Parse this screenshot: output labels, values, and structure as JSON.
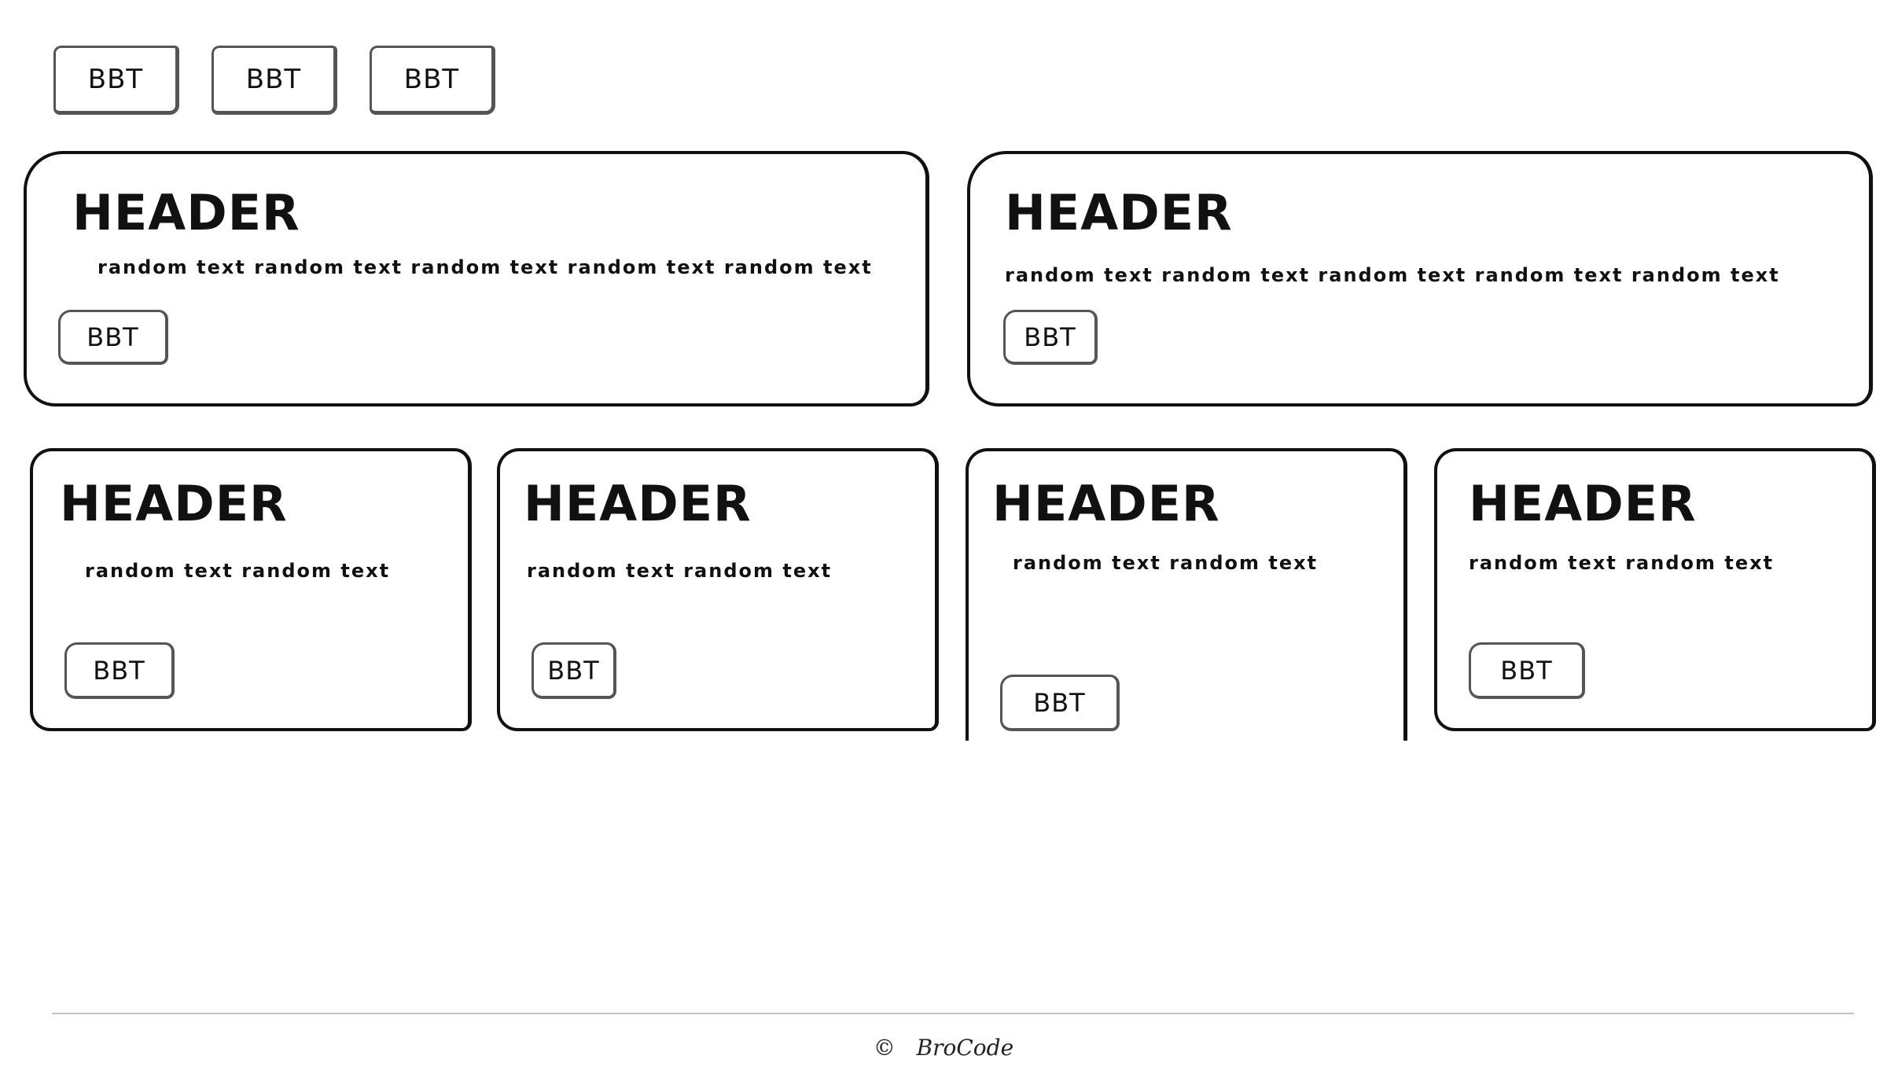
{
  "toolbar": {
    "buttons": [
      {
        "label": "BBT"
      },
      {
        "label": "BBT"
      },
      {
        "label": "BBT"
      }
    ]
  },
  "wide_cards": [
    {
      "header": "HEADER",
      "text": "random text random text random text random text random text",
      "button": "BBT"
    },
    {
      "header": "HEADER",
      "text": "random text random text random text random text random text",
      "button": "BBT"
    }
  ],
  "small_cards": [
    {
      "header": "HEADER",
      "text": "random text random text",
      "button": "BBT"
    },
    {
      "header": "HEADER",
      "text": "random text random text",
      "button": "BBT"
    },
    {
      "header": "HEADER",
      "text": "random text random text",
      "button": "BBT"
    },
    {
      "header": "HEADER",
      "text": "random text random text",
      "button": "BBT"
    }
  ],
  "footer": {
    "copyright_symbol": "©",
    "brand": "BroCode"
  }
}
